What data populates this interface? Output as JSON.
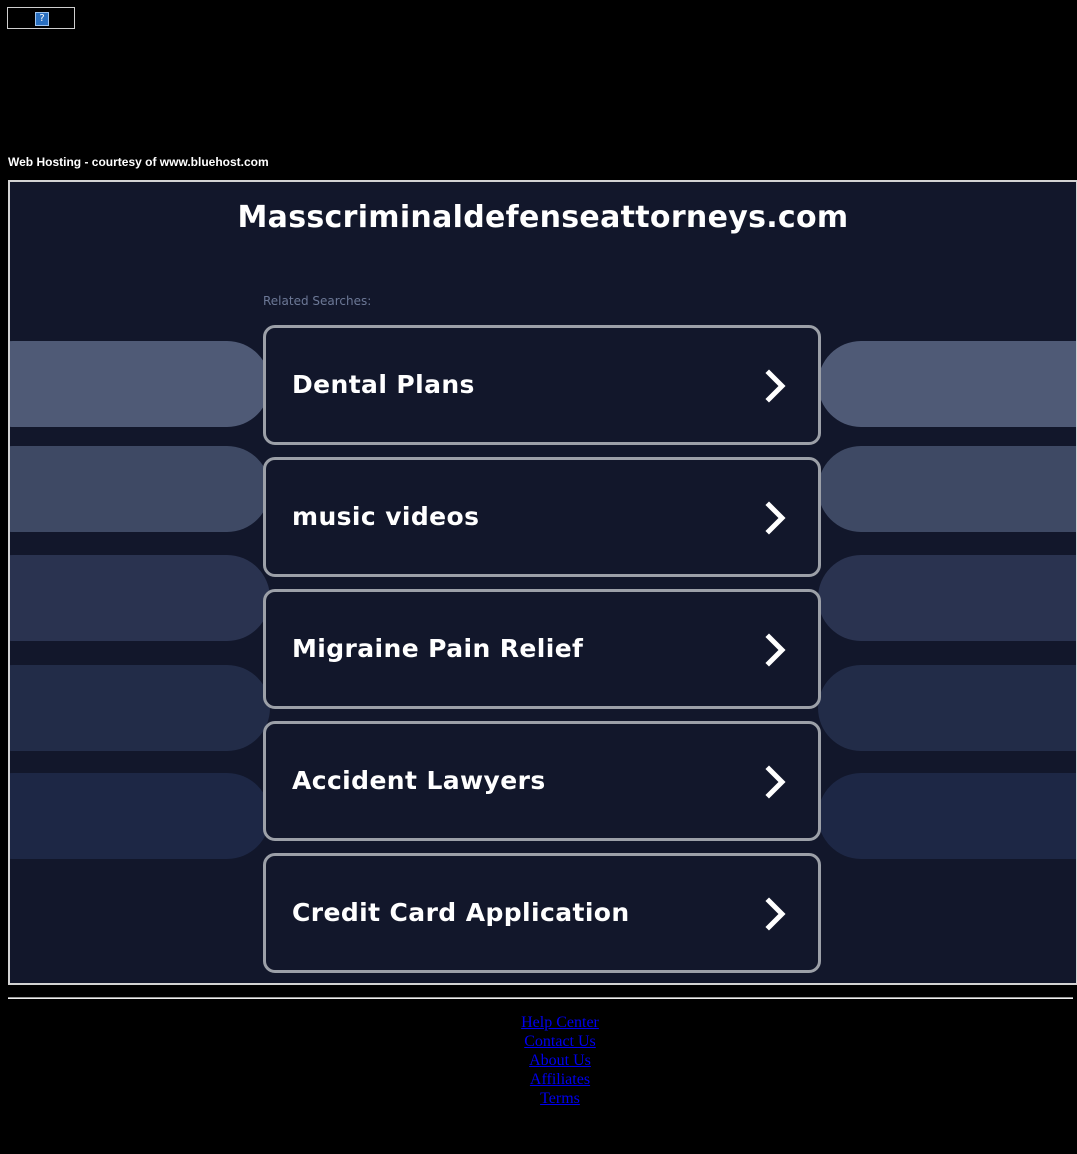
{
  "banner": {
    "icon": "broken-image-icon",
    "icon_glyph": "?"
  },
  "hosting_text": "Web Hosting - courtesy of www.bluehost.com",
  "domain_title": "Masscriminaldefenseattorneys.com",
  "related_label": "Related Searches:",
  "searches": [
    {
      "label": "Dental Plans",
      "icon": "chevron-right-icon"
    },
    {
      "label": "music videos",
      "icon": "chevron-right-icon"
    },
    {
      "label": "Migraine Pain Relief",
      "icon": "chevron-right-icon"
    },
    {
      "label": "Accident Lawyers",
      "icon": "chevron-right-icon"
    },
    {
      "label": "Credit Card Application",
      "icon": "chevron-right-icon"
    }
  ],
  "footer_links": [
    "Help Center",
    "Contact Us",
    "About Us",
    "Affiliates",
    "Terms"
  ],
  "colors": {
    "page_background": "#000000",
    "panel_background": "#12172b",
    "button_border": "#9ca0a8",
    "link": "#0000ee",
    "pill_shades": [
      "#4f5a76",
      "#3e4964",
      "#2a3350",
      "#222c48",
      "#1d2745"
    ]
  }
}
